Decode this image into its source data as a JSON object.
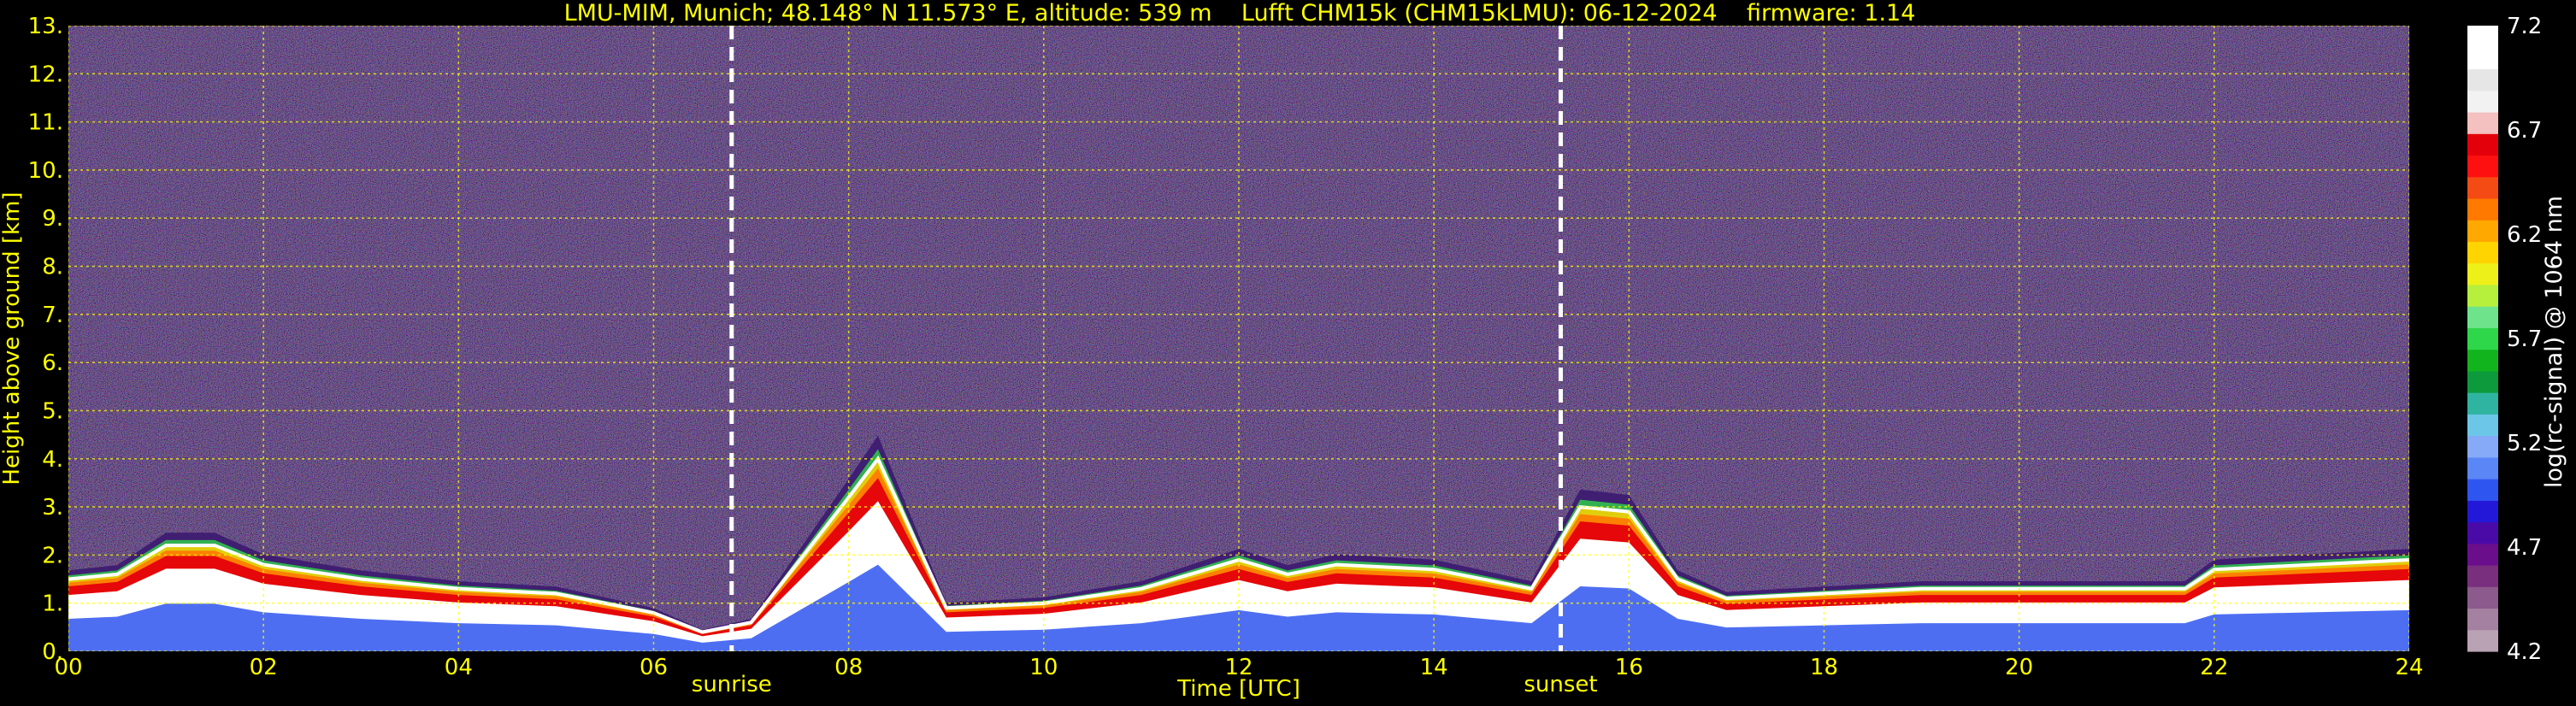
{
  "header": {
    "title": "LMU-MIM, Munich; 48.148° N 11.573° E, altitude: 539 m    Lufft CHM15k (CHM15kLMU): 06-12-2024    firmware: 1.14"
  },
  "colors": {
    "background": "#000000",
    "text": "#ffff00",
    "grid": "#ffff00",
    "colorbar_text": "#ffffff",
    "noise_base": "#2b2340"
  },
  "chart_data": {
    "type": "heatmap",
    "title": "LMU-MIM, Munich; 48.148° N 11.573° E, altitude: 539 m    Lufft CHM15k (CHM15kLMU): 06-12-2024    firmware: 1.14",
    "xlabel": "Time [UTC]",
    "ylabel": "Height above ground [km]",
    "xlim": [
      0,
      24
    ],
    "ylim": [
      0,
      13
    ],
    "x_ticks": [
      0,
      2,
      4,
      6,
      8,
      10,
      12,
      14,
      16,
      18,
      20,
      22,
      24
    ],
    "x_tick_labels": [
      "00",
      "02",
      "04",
      "06",
      "08",
      "10",
      "12",
      "14",
      "16",
      "18",
      "20",
      "22",
      "24"
    ],
    "y_ticks": [
      0,
      1,
      2,
      3,
      4,
      5,
      6,
      7,
      8,
      9,
      10,
      11,
      12,
      13
    ],
    "y_tick_labels": [
      "0.",
      "1.",
      "2.",
      "3.",
      "4.",
      "5.",
      "6.",
      "7.",
      "8.",
      "9.",
      "10.",
      "11.",
      "12.",
      "13."
    ],
    "grid": true,
    "events": [
      {
        "label": "sunrise",
        "time": 6.8
      },
      {
        "label": "sunset",
        "time": 15.3
      }
    ],
    "colorbar": {
      "label": "log(rc-signal) @ 1064 nm",
      "range": [
        4.2,
        7.2
      ],
      "ticks": [
        4.2,
        4.7,
        5.2,
        5.7,
        6.2,
        6.7,
        7.2
      ],
      "tick_labels": [
        "4.2",
        "4.7",
        "5.2",
        "5.7",
        "6.2",
        "6.7",
        "7.2"
      ],
      "colors": [
        "#b9a2b4",
        "#a481a0",
        "#8c5a8c",
        "#7a2f7e",
        "#6a0e8c",
        "#4a0aa8",
        "#2418d8",
        "#2f55f0",
        "#5a86f6",
        "#86aaf8",
        "#6cc6e8",
        "#2eb4a0",
        "#0c9a3c",
        "#12b41e",
        "#2ed64a",
        "#6ee38c",
        "#b6ef3c",
        "#eef01a",
        "#ffd400",
        "#ffa800",
        "#ff7800",
        "#f44a14",
        "#ff1010",
        "#e4000a",
        "#f5c0c0",
        "#f2f2f2",
        "#e6e6e6",
        "#ffffff",
        "#ffffff"
      ]
    },
    "mixing_layer_height_km": [
      {
        "t": 0.0,
        "h": 1.5
      },
      {
        "t": 0.5,
        "h": 1.6
      },
      {
        "t": 1.0,
        "h": 2.2
      },
      {
        "t": 1.5,
        "h": 2.2
      },
      {
        "t": 2.0,
        "h": 1.8
      },
      {
        "t": 3.0,
        "h": 1.5
      },
      {
        "t": 4.0,
        "h": 1.3
      },
      {
        "t": 5.0,
        "h": 1.2
      },
      {
        "t": 6.0,
        "h": 0.8
      },
      {
        "t": 6.5,
        "h": 0.4
      },
      {
        "t": 7.0,
        "h": 0.6
      },
      {
        "t": 8.0,
        "h": 3.2
      },
      {
        "t": 8.3,
        "h": 4.0
      },
      {
        "t": 9.0,
        "h": 0.9
      },
      {
        "t": 10.0,
        "h": 1.0
      },
      {
        "t": 11.0,
        "h": 1.3
      },
      {
        "t": 12.0,
        "h": 1.9
      },
      {
        "t": 12.5,
        "h": 1.6
      },
      {
        "t": 13.0,
        "h": 1.8
      },
      {
        "t": 14.0,
        "h": 1.7
      },
      {
        "t": 15.0,
        "h": 1.3
      },
      {
        "t": 15.5,
        "h": 3.0
      },
      {
        "t": 16.0,
        "h": 2.9
      },
      {
        "t": 16.5,
        "h": 1.5
      },
      {
        "t": 17.0,
        "h": 1.1
      },
      {
        "t": 18.0,
        "h": 1.2
      },
      {
        "t": 19.0,
        "h": 1.3
      },
      {
        "t": 20.0,
        "h": 1.3
      },
      {
        "t": 21.0,
        "h": 1.3
      },
      {
        "t": 21.7,
        "h": 1.3
      },
      {
        "t": 22.0,
        "h": 1.7
      },
      {
        "t": 23.0,
        "h": 1.8
      },
      {
        "t": 24.0,
        "h": 1.9
      }
    ]
  }
}
